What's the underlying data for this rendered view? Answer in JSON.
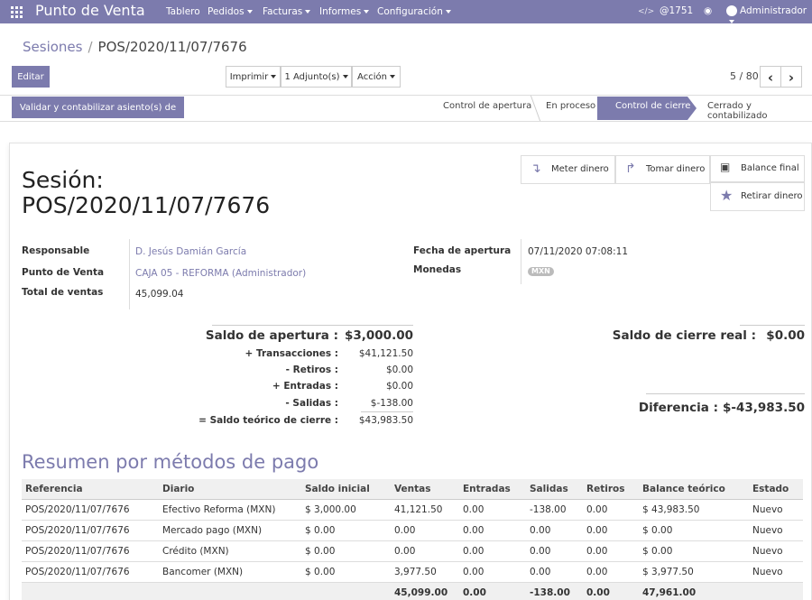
{
  "navbar": {
    "app_title": "Punto de Venta",
    "menus": [
      "Tablero",
      "Pedidos",
      "Facturas",
      "Informes",
      "Configuración"
    ],
    "debug_symbol": "</>",
    "activity_count": "@1751",
    "user": "Administrador",
    "color": "#7c7bad"
  },
  "breadcrumb": {
    "parent": "Sesiones",
    "sep": "/",
    "current": "POS/2020/11/07/7676"
  },
  "toolbar": {
    "edit": "Editar",
    "print": "Imprimir",
    "attachments": "1 Adjunto(s)",
    "action": "Acción",
    "pager": "5 / 80",
    "prev": "‹",
    "next": "›"
  },
  "statusbar": {
    "validate": "Validar y contabilizar asiento(s) de cierre",
    "stages": [
      "Control de apertura",
      "En proceso",
      "Control de cierre",
      "Cerrado y contabilizado"
    ],
    "active_stage": "Control de cierre"
  },
  "smart_buttons": {
    "meter": "Meter dinero",
    "tomar": "Tomar dinero",
    "balance": "Balance final",
    "retirar": "Retirar dinero"
  },
  "title": {
    "label": "Sesión:",
    "name": "POS/2020/11/07/7676"
  },
  "fields": {
    "responsable_label": "Responsable",
    "responsable": "D. Jesús Damián García",
    "pos_label": "Punto de Venta",
    "pos": "CAJA 05 - REFORMA (Administrador)",
    "total_label": "Total de ventas",
    "total": "45,099.04",
    "fecha_label": "Fecha de apertura",
    "fecha": "07/11/2020 07:08:11",
    "monedas_label": "Monedas",
    "moneda": "MXN"
  },
  "balances": {
    "apertura_label": "Saldo de apertura :",
    "apertura": "$3,000.00",
    "rows": [
      {
        "label": "+ Transacciones :",
        "value": "$41,121.50"
      },
      {
        "label": "- Retiros :",
        "value": "$0.00"
      },
      {
        "label": "+ Entradas :",
        "value": "$0.00"
      },
      {
        "label": "- Salidas :",
        "value": "$-138.00"
      },
      {
        "label": "= Saldo teórico de cierre :",
        "value": "$43,983.50"
      }
    ],
    "cierre_label": "Saldo de cierre real :",
    "cierre": "$0.00",
    "diferencia_label": "Diferencia :",
    "diferencia": "$-43,983.50"
  },
  "section_title": "Resumen por métodos de pago",
  "table": {
    "headers": [
      "Referencia",
      "Diario",
      "Saldo inicial",
      "Ventas",
      "Entradas",
      "Salidas",
      "Retiros",
      "Balance teórico",
      "Estado"
    ],
    "rows": [
      [
        "POS/2020/11/07/7676",
        "Efectivo Reforma (MXN)",
        "$ 3,000.00",
        "41,121.50",
        "0.00",
        "-138.00",
        "0.00",
        "$ 43,983.50",
        "Nuevo"
      ],
      [
        "POS/2020/11/07/7676",
        "Mercado pago (MXN)",
        "$ 0.00",
        "0.00",
        "0.00",
        "0.00",
        "0.00",
        "$ 0.00",
        "Nuevo"
      ],
      [
        "POS/2020/11/07/7676",
        "Crédito (MXN)",
        "$ 0.00",
        "0.00",
        "0.00",
        "0.00",
        "0.00",
        "$ 0.00",
        "Nuevo"
      ],
      [
        "POS/2020/11/07/7676",
        "Bancomer (MXN)",
        "$ 0.00",
        "3,977.50",
        "0.00",
        "0.00",
        "0.00",
        "$ 3,977.50",
        "Nuevo"
      ]
    ],
    "footer": [
      "",
      "",
      "",
      "45,099.00",
      "0.00",
      "-138.00",
      "0.00",
      "47,961.00",
      ""
    ]
  }
}
